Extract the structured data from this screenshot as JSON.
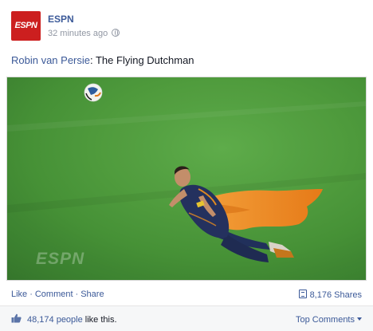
{
  "post": {
    "page_name": "ESPN",
    "avatar_text": "ESPN",
    "timestamp": "32 minutes ago",
    "privacy_icon": "globe-icon",
    "text_link": "Robin van Persie",
    "text_rest": ": The Flying Dutchman",
    "photo": {
      "watermark": "ESPN",
      "grass_color": "#3f8d2e",
      "cape_color": "#f08a24",
      "jersey_color": "#24315e"
    }
  },
  "actions": {
    "like": "Like",
    "comment": "Comment",
    "share": "Share",
    "separator": "·",
    "shares_count": "8,176 Shares"
  },
  "likes": {
    "count": "48,174 people",
    "suffix": " like this.",
    "top_comments": "Top Comments"
  },
  "colors": {
    "brand_red": "#cc1f1f",
    "link_blue": "#3b5998",
    "meta_gray": "#9197a3"
  }
}
